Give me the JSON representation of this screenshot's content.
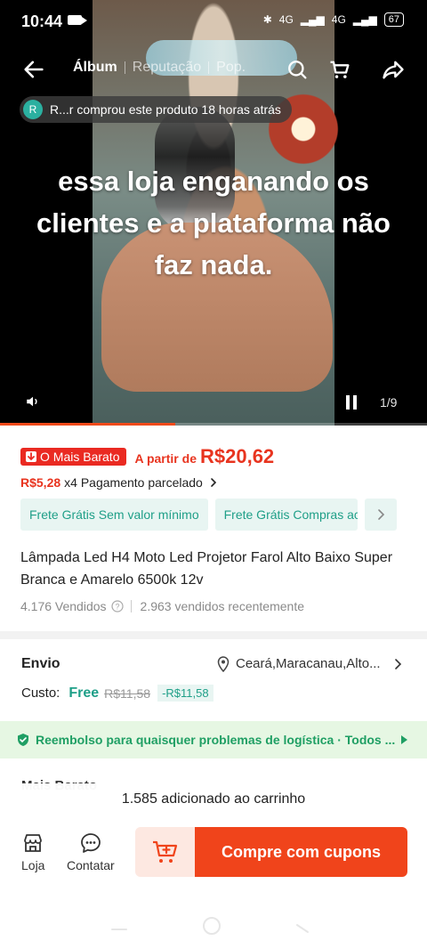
{
  "status_bar": {
    "time": "10:44",
    "network_1": "4G",
    "network_2": "4G",
    "battery": "67"
  },
  "topnav": {
    "tabs": [
      {
        "label": "Álbum",
        "active": true
      },
      {
        "label": "Reputação",
        "active": false
      },
      {
        "label": "Pop.",
        "active": false
      }
    ]
  },
  "video": {
    "purchase_avatar": "R",
    "purchase_text": "R...r comprou este produto 18 horas atrás",
    "overlay_text": "essa loja enganando os clientes e a plataforma não faz nada.",
    "counter": "1/9",
    "progress": 0.41
  },
  "price": {
    "badge": "O Mais Barato",
    "from_label": "A partir de",
    "value": "R$20,62"
  },
  "installment": {
    "amount": "R$5,28",
    "text": "x4 Pagamento parcelado"
  },
  "shipping_tags": [
    "Frete Grátis Sem valor mínimo",
    "Frete Grátis Compras aci"
  ],
  "product": {
    "title": "Lâmpada Led H4 Moto Led Projetor Farol Alto Baixo Super Branca e Amarelo 6500k 12v",
    "sold": "4.176 Vendidos",
    "sold_recent": "2.963 vendidos recentemente"
  },
  "shipping": {
    "label": "Envio",
    "location": "Ceará,Maracanau,Alto...",
    "cost_label": "Custo:",
    "cost_free": "Free",
    "cost_old": "R$11,58",
    "cost_discount": "-R$11,58"
  },
  "refund": {
    "text": "Reembolso para quaisquer problemas de logística · Todos ..."
  },
  "peek_section": "Mais Barato",
  "toast": "1.585 adicionado ao carrinho",
  "bottom_bar": {
    "store_label": "Loja",
    "contact_label": "Contatar",
    "buy_label": "Compre com cupons"
  },
  "colors": {
    "accent": "#f0441b",
    "price_red": "#e8341f",
    "teal": "#1f9f88",
    "green": "#1f9f64"
  }
}
